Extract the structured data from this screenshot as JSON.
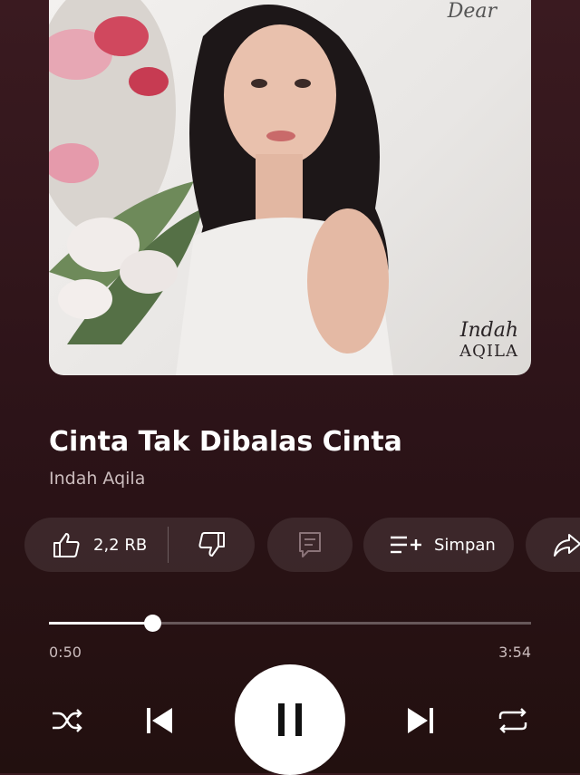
{
  "album_art": {
    "signature_script": "Indah",
    "signature_caps": "AQILA",
    "top_script": "Dear"
  },
  "song": {
    "title": "Cinta Tak Dibalas Cinta",
    "artist": "Indah Aqila"
  },
  "actions": {
    "like_count": "2,2 RB",
    "save_label": "Simpan"
  },
  "playback": {
    "current_time": "0:50",
    "total_time": "3:54",
    "progress": 0.2137
  },
  "icons": {
    "like": "thumbs-up-icon",
    "dislike": "thumbs-down-icon",
    "comment": "comment-icon",
    "save": "playlist-add-icon",
    "share": "share-icon",
    "shuffle": "shuffle-icon",
    "previous": "skip-previous-icon",
    "pause": "pause-icon",
    "next": "skip-next-icon",
    "repeat": "repeat-icon"
  },
  "colors": {
    "background": "#2c1318",
    "accent": "#ffffff"
  }
}
